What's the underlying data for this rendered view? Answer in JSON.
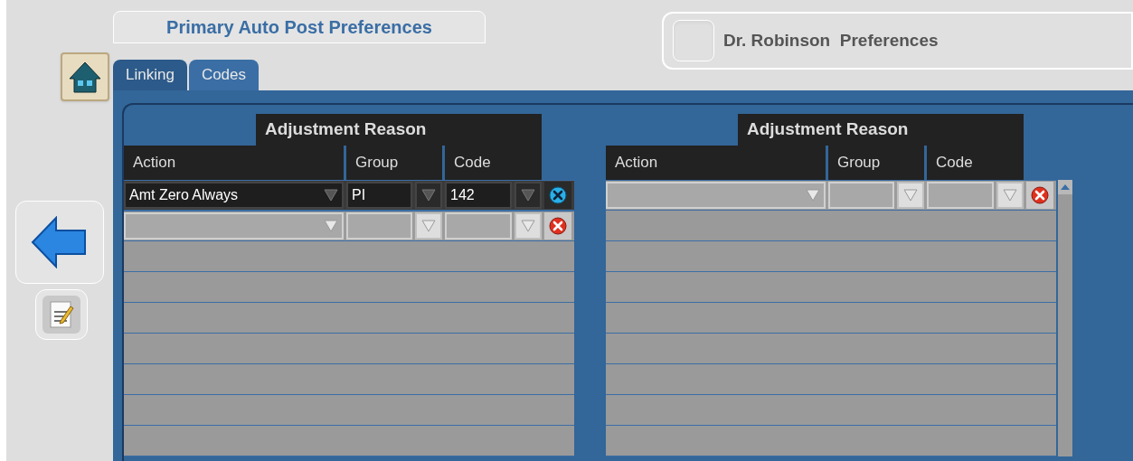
{
  "sidebar": {
    "buttons": [
      {
        "kind": "home"
      },
      {
        "kind": "back"
      },
      {
        "kind": "edit"
      }
    ]
  },
  "title_tab": "Primary Auto Post Preferences",
  "header": {
    "title": "Dr. Robinson  Preferences",
    "checked": false
  },
  "tabs": [
    {
      "label": "Linking",
      "selected": false
    },
    {
      "label": "Codes",
      "selected": true
    }
  ],
  "grids": [
    {
      "group_header": "Adjustment Reason",
      "columns": [
        "Action",
        "Group",
        "Code"
      ],
      "rows": [
        {
          "action": "Amt Zero Always",
          "group": "PI",
          "code": "142",
          "selected": true
        },
        {
          "selected": false
        }
      ]
    },
    {
      "group_header": "Adjustment Reason",
      "columns": [
        "Action",
        "Group",
        "Code"
      ],
      "rows": [
        {
          "selected": false
        }
      ]
    }
  ]
}
